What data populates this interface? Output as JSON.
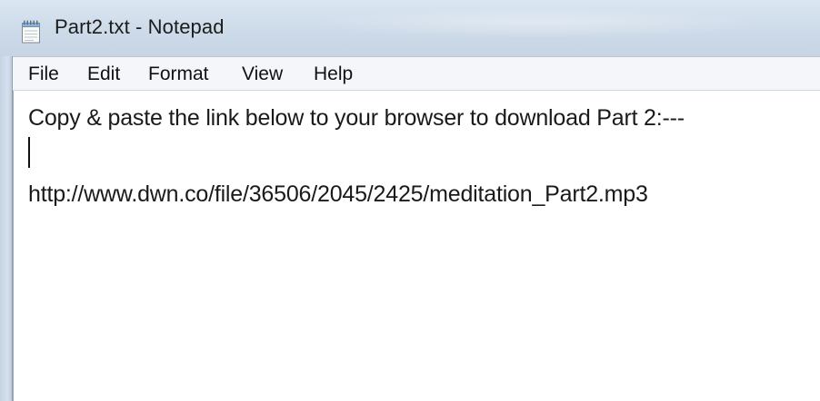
{
  "window": {
    "title": "Part2.txt - Notepad",
    "icon": "notepad-icon"
  },
  "menu": {
    "items": [
      {
        "label": "File"
      },
      {
        "label": "Edit"
      },
      {
        "label": "Format"
      },
      {
        "label": "View"
      },
      {
        "label": "Help"
      }
    ]
  },
  "editor": {
    "lines": [
      "Copy & paste the link below to your browser to download Part 2:---",
      "",
      "http://www.dwn.co/file/36506/2045/2425/meditation_Part2.mp3"
    ]
  }
}
